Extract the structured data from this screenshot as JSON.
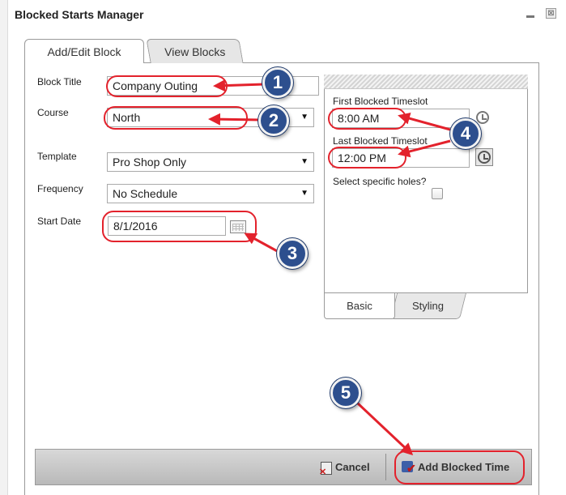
{
  "window": {
    "title": "Blocked Starts Manager",
    "close_glyph": "⊠"
  },
  "tabs": [
    {
      "label": "Add/Edit Block"
    },
    {
      "label": "View Blocks"
    }
  ],
  "form": {
    "block_title": {
      "label": "Block Title",
      "value": "Company Outing"
    },
    "course": {
      "label": "Course",
      "value": "North"
    },
    "template": {
      "label": "Template",
      "value": "Pro Shop Only"
    },
    "frequency": {
      "label": "Frequency",
      "value": "No Schedule"
    },
    "start_date": {
      "label": "Start Date",
      "value": "8/1/2016"
    }
  },
  "timeslots": {
    "first": {
      "label": "First Blocked Timeslot",
      "value": "8:00 AM"
    },
    "last": {
      "label": "Last Blocked Timeslot",
      "value": "12:00 PM"
    },
    "specific_holes_label": "Select specific holes?"
  },
  "sub_tabs": [
    {
      "label": "Basic"
    },
    {
      "label": "Styling"
    }
  ],
  "footer": {
    "cancel_label": "Cancel",
    "add_label": "Add Blocked Time"
  },
  "callouts": [
    "1",
    "2",
    "3",
    "4",
    "5"
  ],
  "colors": {
    "callout": "#2d4f8e",
    "highlight": "#e3222c"
  },
  "icons": [
    "minimize-icon",
    "close-icon",
    "dropdown-arrow-icon",
    "calendar-icon",
    "clock-icon",
    "checkbox",
    "cancel-icon",
    "add-blocked-time-icon"
  ]
}
